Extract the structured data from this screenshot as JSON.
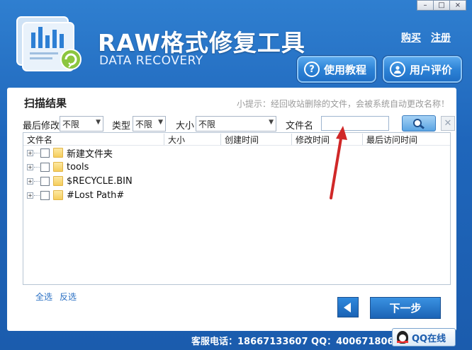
{
  "window": {
    "min": "–",
    "max": "□",
    "close": "×"
  },
  "header": {
    "title": "RAW格式修复工具",
    "subtitle": "DATA RECOVERY",
    "links": {
      "buy": "购买",
      "register": "注册"
    },
    "buttons": {
      "tutorial": "使用教程",
      "review": "用户评价"
    }
  },
  "panel": {
    "title": "扫描结果",
    "hint": "小提示：经回收站删除的文件，会被系统自动更改名称！"
  },
  "filters": {
    "modified_label": "最后修改",
    "modified_value": "不限",
    "type_label": "类型",
    "type_value": "不限",
    "size_label": "大小",
    "size_value": "不限",
    "filename_label": "文件名",
    "filename_value": ""
  },
  "table": {
    "columns": [
      "文件名",
      "大小",
      "创建时间",
      "修改时间",
      "最后访问时间"
    ],
    "rows": [
      {
        "name": "新建文件夹"
      },
      {
        "name": "tools"
      },
      {
        "name": "$RECYCLE.BIN"
      },
      {
        "name": "#Lost Path#"
      }
    ]
  },
  "selection": {
    "select_all": "全选",
    "invert": "反选"
  },
  "nav": {
    "next": "下一步"
  },
  "footer": {
    "contact": "客服电话：18667133607 QQ：4006718068",
    "qq_online": "QQ在线"
  },
  "colors": {
    "bg": "#1f66bb",
    "accent": "#2d83d6",
    "annotation_arrow": "#d02828"
  }
}
